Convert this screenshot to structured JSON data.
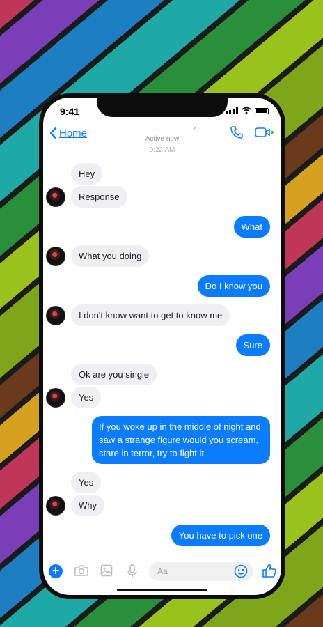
{
  "status": {
    "time": "9:41"
  },
  "header": {
    "back_label": "Home",
    "active_status": "Active now"
  },
  "timestamp": "9:22 AM",
  "messages": [
    {
      "from": "them",
      "text": "Hey"
    },
    {
      "from": "them",
      "text": "Response"
    },
    {
      "from": "me",
      "text": "What"
    },
    {
      "from": "them",
      "text": "What you doing"
    },
    {
      "from": "me",
      "text": "Do I know you"
    },
    {
      "from": "them",
      "text": "I don't know want to get to know me"
    },
    {
      "from": "me",
      "text": "Sure"
    },
    {
      "from": "them",
      "text": "Ok are you single"
    },
    {
      "from": "them",
      "text": "Yes"
    },
    {
      "from": "me",
      "text": "If you woke up in the middle of night and saw a strange figure would you scream, stare in terror, try to fight it"
    },
    {
      "from": "them",
      "text": "Yes"
    },
    {
      "from": "them",
      "text": "Why"
    },
    {
      "from": "me",
      "text": "You have to pick one"
    }
  ],
  "composer": {
    "placeholder": "Aa"
  },
  "colors": {
    "accent": "#0a7cff",
    "incoming_bubble": "#efeff3",
    "online_dot": "#31cc46"
  },
  "icons": [
    "chevron-left-icon",
    "phone-icon",
    "video-icon",
    "plus-icon",
    "camera-icon",
    "image-icon",
    "microphone-icon",
    "emoji-icon",
    "thumbs-up-icon"
  ]
}
